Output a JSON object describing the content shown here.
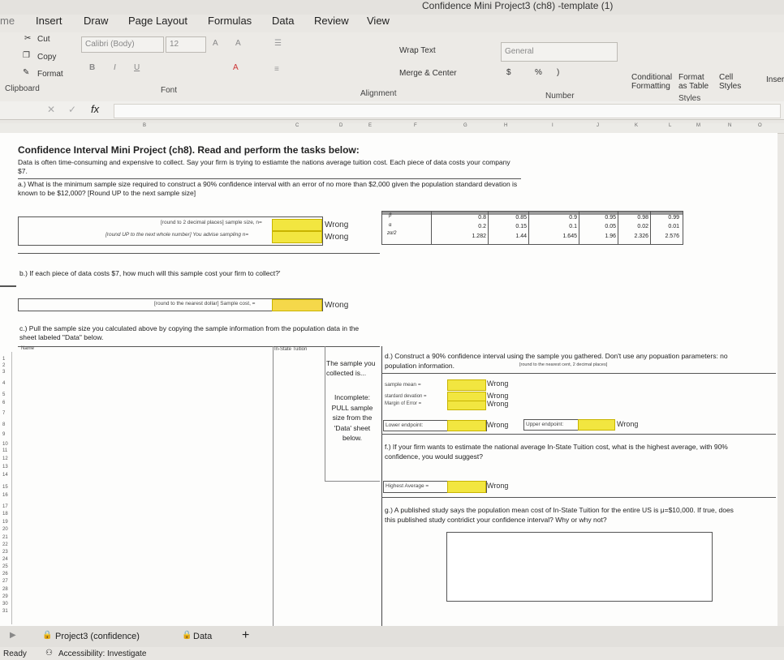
{
  "window": {
    "title": "Confidence Mini Project3 (ch8) -template (1)"
  },
  "ribbon_tabs": [
    "me",
    "Insert",
    "Draw",
    "Page Layout",
    "Formulas",
    "Data",
    "Review",
    "View"
  ],
  "clipboard": {
    "cut": "Cut",
    "copy": "Copy",
    "format": "Format",
    "label": "Clipboard"
  },
  "font": {
    "name": "Calibri (Body)",
    "size": "12",
    "bold": "B",
    "italic": "I",
    "underline": "U",
    "label": "Font",
    "grow": "A",
    "shrink": "A",
    "color_a": "A"
  },
  "alignment": {
    "wrap": "Wrap Text",
    "merge": "Merge & Center",
    "label": "Alignment"
  },
  "number": {
    "format": "General",
    "dollar": "$",
    "percent": "%",
    "comma": ")",
    "label": "Number"
  },
  "styles": {
    "conditional": "Conditional Formatting",
    "format_table": "Format as Table",
    "cell_styles": "Cell Styles",
    "label": "Styles",
    "insert": "Inser"
  },
  "formula_bar": {
    "fx": "fx"
  },
  "columns": [
    "B",
    "C",
    "D",
    "E",
    "F",
    "G",
    "H",
    "I",
    "J",
    "K",
    "L",
    "M",
    "N",
    "O"
  ],
  "project": {
    "heading": "Confidence Interval Mini Project (ch8). Read and perform the tasks below:",
    "intro": "Data is often time-consuming and expensive to collect. Say your firm is trying to estiamte the nations average tuition cost. Each piece of data costs your company $7.",
    "qa": "a.) What is the minimum sample size required to construct a 90% confidence interval with an error of no more than $2,000 given the population standard devation is known to be $12,000? [Round UP to the next sample size]",
    "qa_row1": "[round to 2 decimal places]  sample size, n=",
    "qa_row2": "[round UP to the next whole number]  You advise sampling n=",
    "qb": "b.) If each piece of data costs $7, how much will this sample cost your firm to collect?'",
    "qb_row": "[round to the nearest dollar]  Sample cost, =",
    "qc": "c.) Pull the sample size you calculated above by copying the sample information from the population data in the sheet labeled \"Data\" below.",
    "name_header": "Name",
    "tuition_header": "In-State Tuition",
    "collected": "The sample you collected is...",
    "incomplete": "Incomplete: PULL sample size from the 'Data' sheet below.",
    "qd": "d.) Construct a 90% confidence interval using the sample you gathered. Don't use any popuation parameters: no population information.",
    "qd_note": "[round to the nearest cent, 2 decimal places]",
    "sample_mean": "sample mean =",
    "std_dev": "stardard devation =",
    "margin": "Margin of Error =",
    "lower": "Lower endpoint:",
    "upper": "Upper endpoint:",
    "qf": "f.) If your firm wants to estimate the national average In-State Tuition cost, what is the highest average, with 90% confidence, you would suggest?",
    "highest": "Highest Average =",
    "qg": "g.) A published study says the population mean cost of In-State Tuition for the entire US is μ=$10,000. If true, does this published study contridict your confidence interval? Why or why not?",
    "wrong": "Wrong"
  },
  "z_table": {
    "labels": [
      "β",
      "α",
      "zα/2"
    ],
    "beta": [
      "0.8",
      "0.85",
      "0.9",
      "0.95",
      "0.98",
      "0.99"
    ],
    "alpha": [
      "0.2",
      "0.15",
      "0.1",
      "0.05",
      "0.02",
      "0.01"
    ],
    "z": [
      "1.282",
      "1.44",
      "1.645",
      "1.96",
      "2.326",
      "2.576"
    ]
  },
  "row_numbers": [
    "1",
    "2",
    "3",
    "4",
    "5",
    "6",
    "7",
    "8",
    "9",
    "10",
    "11",
    "12",
    "13",
    "14",
    "15",
    "16",
    "17",
    "18",
    "19",
    "20",
    "21",
    "22",
    "23",
    "24",
    "25",
    "26",
    "27",
    "28",
    "29",
    "30",
    "31"
  ],
  "sheet_tabs": [
    "Project3 (confidence)",
    "Data"
  ],
  "status": {
    "ready": "Ready",
    "accessibility": "Accessibility: Investigate"
  }
}
